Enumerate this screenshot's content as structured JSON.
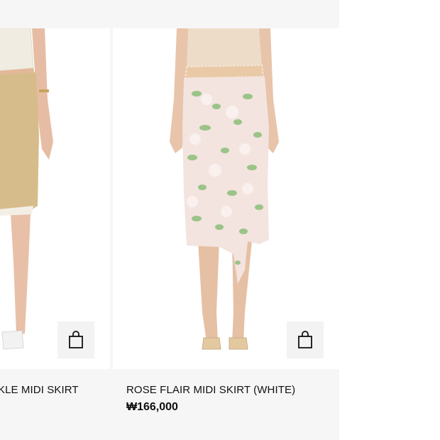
{
  "products": [
    {
      "name": "KLE MIDI SKIRT",
      "icon": "shopping-bag-icon",
      "bag_label": "Add to bag"
    },
    {
      "name": "ROSE FLAIR MIDI SKIRT (WHITE)",
      "price": "₩166,000",
      "icon": "shopping-bag-icon",
      "bag_label": "Add to bag"
    }
  ],
  "colors": {
    "page_background": "#ffffff",
    "strip_background": "#f6f6f6",
    "card_background": "#ffffff",
    "button_background": "#f3f3f3",
    "text": "#111111"
  }
}
